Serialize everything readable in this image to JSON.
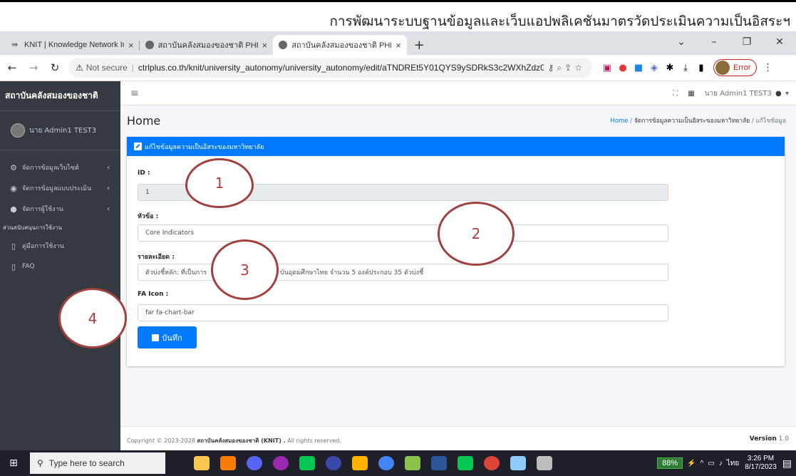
{
  "caption": "การพัฒนาระบบฐานข้อมูลและเว็บแอปพลิเคชันมาตรวัดประเมินความเป็นอิสระฯ",
  "browser": {
    "tabs": [
      {
        "label": "KNIT | Knowledge Network Instit",
        "close": "×"
      },
      {
        "label": "สถาบันคลังสมองของชาติ PHP CI MA",
        "close": "×"
      },
      {
        "label": "สถาบันคลังสมองของชาติ PHP CI MA",
        "close": "×"
      }
    ],
    "new_tab": "+",
    "not_secure": "Not secure",
    "url": "ctrlplus.co.th/knit/university_autonomy/university_autonomy/edit/aTNDREt5Y01QYS9ySDRkS3c2WXhZdz09",
    "error_label": "Error"
  },
  "sidebar": {
    "brand": "สถาบันคลังสมองของชาติ",
    "user": "นาย Admin1 TEST3",
    "items": [
      {
        "label": "จัดการข้อมูลเว็บไซต์",
        "chevron": "‹"
      },
      {
        "label": "จัดการข้อมูลแบบประเมิน",
        "chevron": "‹"
      },
      {
        "label": "จัดการผู้ใช้งาน",
        "chevron": "‹"
      }
    ],
    "section_header": "ส่วนสนับสนุนการใช้งาน",
    "support_items": [
      {
        "label": "คู่มือการใช้งาน"
      },
      {
        "label": "FAQ"
      }
    ]
  },
  "topnav": {
    "user": "นาย Admin1 TEST3"
  },
  "page": {
    "title": "Home",
    "breadcrumb": {
      "home": "Home",
      "sep": "/",
      "mid": "จัดการข้อมูลความเป็นอิสระของมหาวิทยาลัย",
      "current": "แก้ไขข้อมูล"
    }
  },
  "form": {
    "header": "แก้ไขข้อมูลความเป็นอิสระของมหาวิทยาลัย",
    "id_label": "ID :",
    "id_value": "1",
    "topic_label": "หัวข้อ :",
    "topic_value": "Core Indicators",
    "detail_label": "รายละเอียด :",
    "detail_value": "ตัวบ่งชี้หลัก: ที่เป็นการ                                    บันอุดมศึกษาไทย จำนวน 5 องค์ประกอบ 35 ตัวบ่งชี้",
    "icon_label": "FA Icon :",
    "icon_value": "far fa-chart-bar",
    "save_label": "บันทึก"
  },
  "footer": {
    "copyright_prefix": "Copyright © 2023-2028",
    "org": "สถาบันคลังสมองของชาติ (KNIT) .",
    "rights": "All rights reserved.",
    "version_label": "Version",
    "version": "1.0"
  },
  "callouts": [
    "1",
    "2",
    "3",
    "4"
  ],
  "taskbar": {
    "search_placeholder": "Type here to search",
    "battery": "88%",
    "lang": "ไทย",
    "time": "3:26 PM",
    "date": "8/17/2023"
  }
}
